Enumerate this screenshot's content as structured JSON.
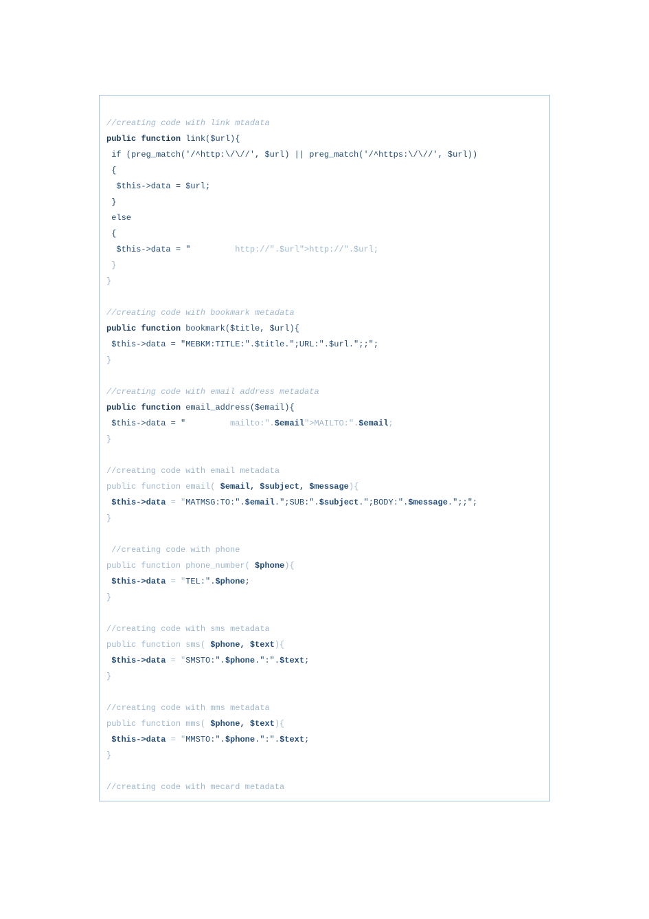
{
  "code": {
    "lines": [
      [],
      [
        {
          "cls": "cmt-italic",
          "t": "//creating code with link mtadata"
        }
      ],
      [
        {
          "cls": "kw-bold",
          "t": "public function"
        },
        {
          "cls": "plain",
          "t": " link($url){"
        }
      ],
      [
        {
          "cls": "plain",
          "t": " if (preg_match('/^http:\\/\\//', $url) || preg_match('/^https:\\/\\//', $url))"
        }
      ],
      [
        {
          "cls": "plain",
          "t": " {"
        }
      ],
      [
        {
          "cls": "plain",
          "t": "  $this->data = $url;"
        }
      ],
      [
        {
          "cls": "plain",
          "t": " }"
        }
      ],
      [
        {
          "cls": "plain",
          "t": " else"
        }
      ],
      [
        {
          "cls": "plain",
          "t": " {"
        }
      ],
      [
        {
          "cls": "plain",
          "t": "  $this->data = \""
        },
        {
          "cls": "light",
          "t": "         http://\".$url\">http://\".$url;"
        }
      ],
      [
        {
          "cls": "light",
          "t": " }"
        }
      ],
      [
        {
          "cls": "light",
          "t": "}"
        }
      ],
      [],
      [
        {
          "cls": "cmt-italic",
          "t": "//creating code with bookmark metadata"
        }
      ],
      [
        {
          "cls": "kw-bold",
          "t": "public function"
        },
        {
          "cls": "plain",
          "t": " bookmark($title, $url){"
        }
      ],
      [
        {
          "cls": "plain",
          "t": " $this->data = \"MEBKM:TITLE:\".$title.\";URL:\".$url.\";;\";"
        }
      ],
      [
        {
          "cls": "light",
          "t": "}"
        }
      ],
      [],
      [
        {
          "cls": "cmt-italic",
          "t": "//creating code with email address metadata"
        }
      ],
      [
        {
          "cls": "kw-bold",
          "t": "public function"
        },
        {
          "cls": "plain",
          "t": " email_address($email){"
        }
      ],
      [
        {
          "cls": "plain",
          "t": " $this->data = \""
        },
        {
          "cls": "light",
          "t": "         mailto:\"."
        },
        {
          "cls": "bold",
          "t": "$email"
        },
        {
          "cls": "light",
          "t": "\">MAILTO:\"."
        },
        {
          "cls": "bold",
          "t": "$email"
        },
        {
          "cls": "light",
          "t": ";"
        }
      ],
      [
        {
          "cls": "light",
          "t": "}"
        }
      ],
      [],
      [
        {
          "cls": "light",
          "t": "//creating code with email metadata"
        }
      ],
      [
        {
          "cls": "light",
          "t": "public function email( "
        },
        {
          "cls": "bold",
          "t": "$email, $subject, $message"
        },
        {
          "cls": "light",
          "t": "){"
        }
      ],
      [
        {
          "cls": "light",
          "t": " "
        },
        {
          "cls": "bold",
          "t": "$this->data"
        },
        {
          "cls": "light",
          "t": " = \""
        },
        {
          "cls": "plain",
          "t": "MATMSG:TO:\"."
        },
        {
          "cls": "bold",
          "t": "$email"
        },
        {
          "cls": "plain",
          "t": ".\";SUB:\"."
        },
        {
          "cls": "bold",
          "t": "$subject"
        },
        {
          "cls": "plain",
          "t": ".\";BODY:\"."
        },
        {
          "cls": "bold",
          "t": "$message"
        },
        {
          "cls": "plain",
          "t": ".\";;\";"
        }
      ],
      [
        {
          "cls": "light",
          "t": "}"
        }
      ],
      [],
      [
        {
          "cls": "light",
          "t": " //creating code with phone"
        }
      ],
      [
        {
          "cls": "light",
          "t": "public function phone_number( "
        },
        {
          "cls": "bold",
          "t": "$phone"
        },
        {
          "cls": "light",
          "t": "){"
        }
      ],
      [
        {
          "cls": "light",
          "t": " "
        },
        {
          "cls": "bold",
          "t": "$this->data"
        },
        {
          "cls": "light",
          "t": " = \""
        },
        {
          "cls": "plain",
          "t": "TEL:\"."
        },
        {
          "cls": "bold",
          "t": "$phone"
        },
        {
          "cls": "plain",
          "t": ";"
        }
      ],
      [
        {
          "cls": "light",
          "t": "}"
        }
      ],
      [],
      [
        {
          "cls": "light",
          "t": "//creating code with sms metadata"
        }
      ],
      [
        {
          "cls": "light",
          "t": "public function sms( "
        },
        {
          "cls": "bold",
          "t": "$phone, $text"
        },
        {
          "cls": "light",
          "t": "){"
        }
      ],
      [
        {
          "cls": "light",
          "t": " "
        },
        {
          "cls": "bold",
          "t": "$this->data"
        },
        {
          "cls": "light",
          "t": " = \""
        },
        {
          "cls": "plain",
          "t": "SMSTO:\"."
        },
        {
          "cls": "bold",
          "t": "$phone"
        },
        {
          "cls": "plain",
          "t": ".\":\"."
        },
        {
          "cls": "bold",
          "t": "$text"
        },
        {
          "cls": "plain",
          "t": ";"
        }
      ],
      [
        {
          "cls": "light",
          "t": "}"
        }
      ],
      [],
      [
        {
          "cls": "light",
          "t": "//creating code with mms metadata"
        }
      ],
      [
        {
          "cls": "light",
          "t": "public function mms( "
        },
        {
          "cls": "bold",
          "t": "$phone, $text"
        },
        {
          "cls": "light",
          "t": "){"
        }
      ],
      [
        {
          "cls": "light",
          "t": " "
        },
        {
          "cls": "bold",
          "t": "$this->data"
        },
        {
          "cls": "light",
          "t": " = \""
        },
        {
          "cls": "plain",
          "t": "MMSTO:\"."
        },
        {
          "cls": "bold",
          "t": "$phone"
        },
        {
          "cls": "plain",
          "t": ".\":\"."
        },
        {
          "cls": "bold",
          "t": "$text"
        },
        {
          "cls": "plain",
          "t": ";"
        }
      ],
      [
        {
          "cls": "light",
          "t": "}"
        }
      ],
      [],
      [
        {
          "cls": "light",
          "t": "//creating code with mecard metadata"
        }
      ]
    ]
  }
}
